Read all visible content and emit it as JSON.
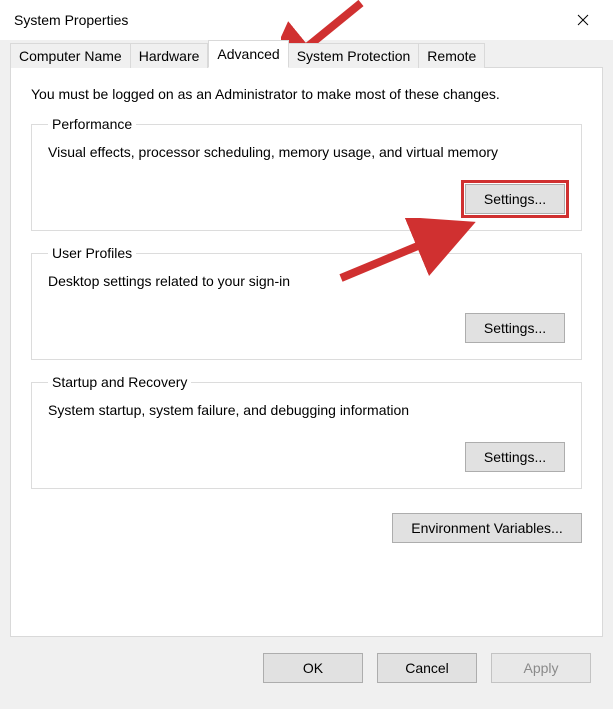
{
  "window": {
    "title": "System Properties"
  },
  "tabs": {
    "computer_name": "Computer Name",
    "hardware": "Hardware",
    "advanced": "Advanced",
    "system_protection": "System Protection",
    "remote": "Remote",
    "active": "advanced"
  },
  "panel": {
    "admin_note": "You must be logged on as an Administrator to make most of these changes.",
    "performance": {
      "legend": "Performance",
      "desc": "Visual effects, processor scheduling, memory usage, and virtual memory",
      "settings_label": "Settings..."
    },
    "user_profiles": {
      "legend": "User Profiles",
      "desc": "Desktop settings related to your sign-in",
      "settings_label": "Settings..."
    },
    "startup_recovery": {
      "legend": "Startup and Recovery",
      "desc": "System startup, system failure, and debugging information",
      "settings_label": "Settings..."
    },
    "env_vars_label": "Environment Variables..."
  },
  "footer": {
    "ok": "OK",
    "cancel": "Cancel",
    "apply": "Apply"
  },
  "annotations": {
    "arrow_color": "#d03030"
  }
}
